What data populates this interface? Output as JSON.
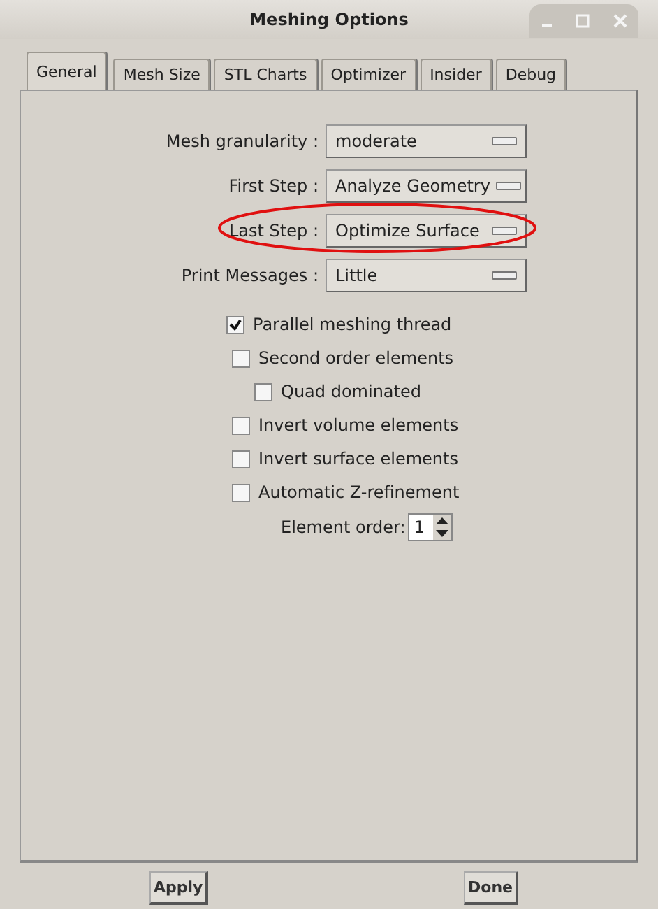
{
  "window": {
    "title": "Meshing Options"
  },
  "tabs": [
    {
      "label": "General",
      "selected": true
    },
    {
      "label": "Mesh Size",
      "selected": false
    },
    {
      "label": "STL Charts",
      "selected": false
    },
    {
      "label": "Optimizer",
      "selected": false
    },
    {
      "label": "Insider",
      "selected": false
    },
    {
      "label": "Debug",
      "selected": false
    }
  ],
  "fields": [
    {
      "label": "Mesh granularity :",
      "value": "moderate",
      "highlighted": false
    },
    {
      "label": "First Step :",
      "value": "Analyze Geometry",
      "highlighted": false
    },
    {
      "label": "Last Step :",
      "value": "Optimize Surface",
      "highlighted": true
    },
    {
      "label": "Print Messages :",
      "value": "Little",
      "highlighted": false
    }
  ],
  "options": [
    {
      "label": "Parallel meshing thread",
      "checked": true
    },
    {
      "label": "Second order elements",
      "checked": false,
      "children": [
        {
          "label": "Quad dominated",
          "checked": false
        }
      ]
    },
    {
      "label": "Invert volume elements",
      "checked": false
    },
    {
      "label": "Invert surface elements",
      "checked": false
    },
    {
      "label": "Automatic Z-refinement",
      "checked": false
    }
  ],
  "element_order": {
    "label": "Element order:",
    "value": "1"
  },
  "buttons": [
    "Apply",
    "Done"
  ]
}
